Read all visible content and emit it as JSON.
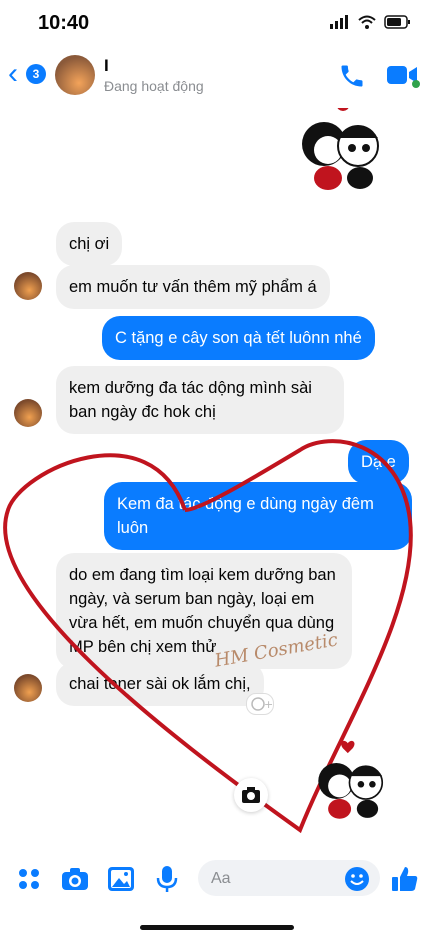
{
  "status_bar": {
    "time": "10:40"
  },
  "header": {
    "back_badge": "3",
    "contact_name": "I",
    "contact_status": "Đang hoạt động"
  },
  "messages": [
    {
      "side": "in",
      "text": "chị ơi"
    },
    {
      "side": "in",
      "text": "em muốn tư vấn thêm mỹ phẩm á"
    },
    {
      "side": "out",
      "text": "C tặng e cây son qà tết luônn nhé"
    },
    {
      "side": "in",
      "text": "kem dưỡng đa tác dộng mình sài ban ngày đc hok chị"
    },
    {
      "side": "out",
      "text": "Dạ e"
    },
    {
      "side": "out",
      "text": "Kem đa tác động e dùng ngày đêm luôn"
    },
    {
      "side": "in",
      "text": "do em đang tìm loại kem dưỡng ban ngày, và serum ban ngày, loại em vừa hết, em muốn chuyển qua dùng MP bên chị xem thử"
    },
    {
      "side": "in",
      "text": "chai toner sài ok lắm chị,"
    }
  ],
  "watermark": "HM Cosmetic",
  "composer": {
    "placeholder": "Aa"
  },
  "colors": {
    "accent": "#0a7cff",
    "heart": "#c0141e"
  }
}
